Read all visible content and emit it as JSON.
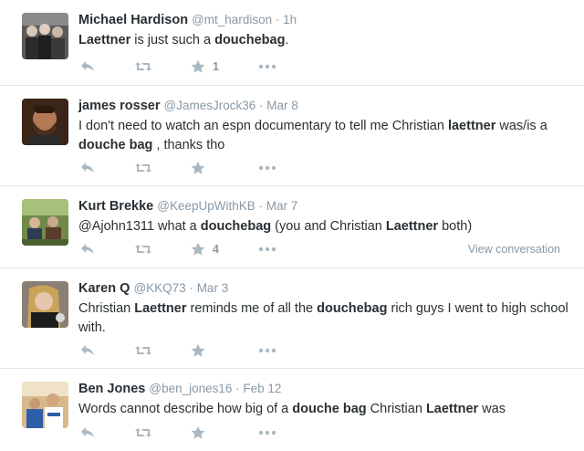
{
  "tweets": [
    {
      "name": "Michael Hardison",
      "handle": "@mt_hardison",
      "time": "1h",
      "text": [
        {
          "t": "Laettner",
          "b": true
        },
        {
          "t": " is just such a ",
          "b": false
        },
        {
          "t": "douchebag",
          "b": true
        },
        {
          "t": ".",
          "b": false
        }
      ],
      "favorites": "1",
      "view_conversation": ""
    },
    {
      "name": "james rosser",
      "handle": "@JamesJrock36",
      "time": "Mar 8",
      "text": [
        {
          "t": "I don't need to watch an espn documentary to tell me Christian ",
          "b": false
        },
        {
          "t": "laettner",
          "b": true
        },
        {
          "t": " was/is a ",
          "b": false
        },
        {
          "t": "douche bag",
          "b": true
        },
        {
          "t": " , thanks tho",
          "b": false
        }
      ],
      "favorites": "",
      "view_conversation": ""
    },
    {
      "name": "Kurt Brekke",
      "handle": "@KeepUpWithKB",
      "time": "Mar 7",
      "text": [
        {
          "t": "@Ajohn1311",
          "b": false
        },
        {
          "t": " what a ",
          "b": false
        },
        {
          "t": "douchebag",
          "b": true
        },
        {
          "t": " (you and Christian ",
          "b": false
        },
        {
          "t": "Laettner",
          "b": true
        },
        {
          "t": " both)",
          "b": false
        }
      ],
      "favorites": "4",
      "view_conversation": "View conversation"
    },
    {
      "name": "Karen Q",
      "handle": "@KKQ73",
      "time": "Mar 3",
      "text": [
        {
          "t": "Christian ",
          "b": false
        },
        {
          "t": "Laettner",
          "b": true
        },
        {
          "t": " reminds me of all the ",
          "b": false
        },
        {
          "t": "douchebag",
          "b": true
        },
        {
          "t": " rich guys I went to high school with.",
          "b": false
        }
      ],
      "favorites": "",
      "view_conversation": ""
    },
    {
      "name": "Ben Jones",
      "handle": "@ben_jones16",
      "time": "Feb 12",
      "text": [
        {
          "t": "Words cannot describe how big of a ",
          "b": false
        },
        {
          "t": "douche bag",
          "b": true
        },
        {
          "t": " Christian ",
          "b": false
        },
        {
          "t": "Laettner",
          "b": true
        },
        {
          "t": " was",
          "b": false
        }
      ],
      "favorites": "",
      "view_conversation": ""
    }
  ],
  "separator": " · ",
  "icons": {
    "reply": "reply-icon",
    "retweet": "retweet-icon",
    "favorite": "star-icon",
    "more": "more-icon"
  },
  "colors": {
    "text": "#292f33",
    "meta": "#8899a6",
    "action": "#aab8c2",
    "divider": "#e1e8ed"
  }
}
